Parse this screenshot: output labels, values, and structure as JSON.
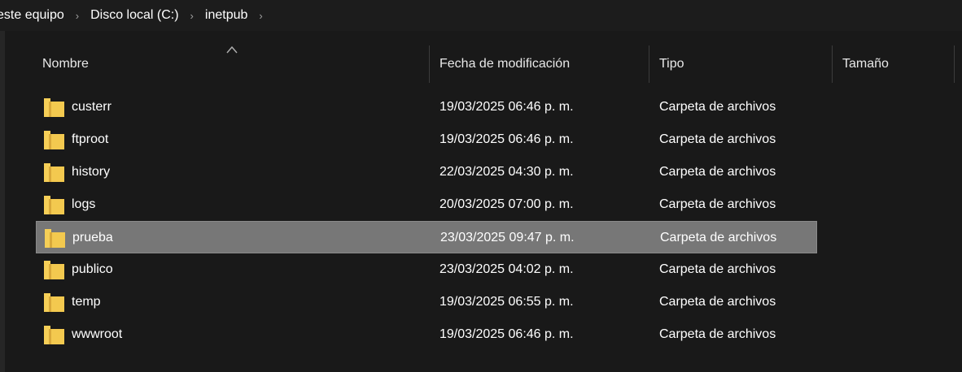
{
  "breadcrumb": {
    "items": [
      "este equipo",
      "Disco local (C:)",
      "inetpub"
    ],
    "separator": "›"
  },
  "columns": {
    "name": "Nombre",
    "date": "Fecha de modificación",
    "type": "Tipo",
    "size": "Tamaño"
  },
  "sort": {
    "column": "name",
    "direction": "ascending",
    "icon": "chevron-up-icon"
  },
  "files": [
    {
      "name": "custerr",
      "date": "19/03/2025 06:46 p. m.",
      "type": "Carpeta de archivos",
      "size": "",
      "icon": "folder-icon"
    },
    {
      "name": "ftproot",
      "date": "19/03/2025 06:46 p. m.",
      "type": "Carpeta de archivos",
      "size": "",
      "icon": "folder-icon"
    },
    {
      "name": "history",
      "date": "22/03/2025 04:30 p. m.",
      "type": "Carpeta de archivos",
      "size": "",
      "icon": "folder-icon"
    },
    {
      "name": "logs",
      "date": "20/03/2025 07:00 p. m.",
      "type": "Carpeta de archivos",
      "size": "",
      "icon": "folder-icon"
    },
    {
      "name": "prueba",
      "date": "23/03/2025 09:47 p. m.",
      "type": "Carpeta de archivos",
      "size": "",
      "icon": "folder-icon",
      "selected": true
    },
    {
      "name": "publico",
      "date": "23/03/2025 04:02 p. m.",
      "type": "Carpeta de archivos",
      "size": "",
      "icon": "folder-icon"
    },
    {
      "name": "temp",
      "date": "19/03/2025 06:55 p. m.",
      "type": "Carpeta de archivos",
      "size": "",
      "icon": "folder-icon"
    },
    {
      "name": "wwwroot",
      "date": "19/03/2025 06:46 p. m.",
      "type": "Carpeta de archivos",
      "size": "",
      "icon": "folder-icon"
    }
  ],
  "colors": {
    "background": "#191919",
    "selection": "#777777",
    "folder": "#f3c94f",
    "text": "#ffffff"
  }
}
